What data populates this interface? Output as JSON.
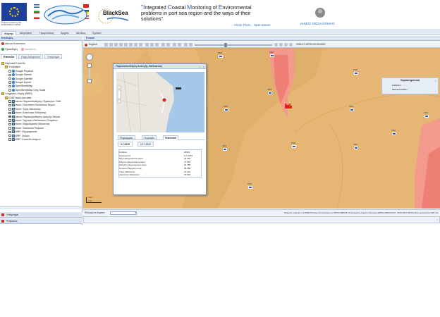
{
  "header": {
    "eu_caption": "Project funded by the EUROPEAN UNION",
    "title_segments": [
      {
        "cap": "\"I",
        "rest": "ntegrated "
      },
      {
        "cap": "C",
        "rest": "oastal "
      },
      {
        "cap": "M",
        "rest": "onitoring of "
      },
      {
        "cap": "E",
        "rest": "nvironmental"
      }
    ],
    "title_line2": "problems in port sea region and the ways of their",
    "title_line3": "solutions\"",
    "slogan": "Clean Ports... Open Doors",
    "municipality": "ΔΗΜΟΣ ΘΕΣΣΑΛΟΝΙΚΗΣ",
    "blacksea_logo": "BlackSea"
  },
  "menu": [
    "Χάρτης",
    "Μετρήσεις",
    "Προγνώσεις",
    "Αρχεία",
    "Μελέτες",
    "Σχετικά"
  ],
  "left": {
    "panel_title": "Επιλογές",
    "lang": "Δίκτυο Κατόπτων",
    "tools": [
      "Προσθήκη",
      "Αφαίρεση"
    ],
    "tabs": [
      "Επίπεδα",
      "Πηγή Δεδομένων",
      "Υπόμνημα"
    ],
    "tree": [
      {
        "label": "Θεματικά Επίπεδα",
        "indent": 0,
        "kind": "folder"
      },
      {
        "label": "Υπόβαθρα",
        "indent": 1,
        "kind": "folder"
      },
      {
        "label": "Google Physical",
        "indent": 2,
        "kind": "globe"
      },
      {
        "label": "Google Streets",
        "indent": 2,
        "kind": "globe"
      },
      {
        "label": "Google Satellite",
        "indent": 2,
        "kind": "globe"
      },
      {
        "label": "Google Hybrid",
        "indent": 2,
        "kind": "globe"
      },
      {
        "label": "OpenStreetMap",
        "indent": 2,
        "kind": "globe"
      },
      {
        "label": "OpenStreetMap Grey Scale",
        "indent": 2,
        "kind": "globe"
      },
      {
        "label": "Υπηρεσίες Χάρτη (WMS)",
        "indent": 0,
        "kind": "folder"
      },
      {
        "label": "ICME black sea data",
        "indent": 1,
        "kind": "folder"
      },
      {
        "label": "Δίκτυο Παρακολούθησης Παράκτιων Υδάτ",
        "indent": 2,
        "kind": "check"
      },
      {
        "label": "ekom: Πυκνότητα Θαλάσσιου Νερού",
        "indent": 2,
        "kind": "check"
      },
      {
        "label": "ekom: Υψος Θάλασσας",
        "indent": 2,
        "kind": "check"
      },
      {
        "label": "ekom: Αλατότητα Θαλάσσης",
        "indent": 2,
        "kind": "check"
      },
      {
        "label": "Δίκτυο Παρακολούθησης Ακτογής Θάλασ",
        "indent": 2,
        "kind": "check-on"
      },
      {
        "label": "ekom: Ταχύτητα Θαλάσσιων Ρευμάτων",
        "indent": 2,
        "kind": "check"
      },
      {
        "label": "ekom: Θερμοκρασία Θάλασσας",
        "indent": 2,
        "kind": "check"
      },
      {
        "label": "ekom: Θαλάσσια Ρεύματα",
        "indent": 2,
        "kind": "check"
      },
      {
        "label": "WRF: Θερμοκρασία",
        "indent": 2,
        "kind": "check"
      },
      {
        "label": "WRF: Ανέμοι",
        "indent": 2,
        "kind": "check"
      },
      {
        "label": "WRF: Επίπεδο Ανέμων",
        "indent": 2,
        "kind": "check"
      }
    ],
    "bottom_panels": [
      "Υπόμνημα",
      "Ρυθμίσεις"
    ]
  },
  "map": {
    "tab": "Γενικά",
    "lang_label": "English",
    "datetime": "2015-07-09T22:00:00.000Z",
    "station_label": "UMA",
    "selected_station": "UMA",
    "legend": {
      "title": "Χαρακτηριστικά",
      "items": [
        "ΣΗΜΑΔΑ",
        "ΘΕΣΣΑΛΟΝΙΚΗ"
      ]
    },
    "scale": {
      "top": "1 km",
      "bottom": "1 mi"
    },
    "status_left": "Επιλογή σε κλίμακα:",
    "status_right": "Τρέχουσα κλίμακα: 1:136484  Σύστημα Συντεταγμένων: EPSG:900913  Συντεταγμένες Σημείου Κέρσορα (EPSG:4326):23.03 , 40.60  GET SDI Portal is powered by GET Ltd.",
    "colors": {
      "map_bg": "#eabd7a",
      "hot": "#f39a8c",
      "hotter": "#ee7f74",
      "sea": "#dfb06c"
    }
  },
  "popup": {
    "title": "Παρακολούθηση Ακτογής Θάλασσας",
    "tabs": [
      "Πληροφορίες",
      "Γεωμετρία",
      "Στατιστικά"
    ],
    "date_tabs": [
      "9-7-2015",
      "10-7-2015"
    ],
    "stats": [
      {
        "k": "Σταθμός",
        "v": "18954"
      },
      {
        "k": "Ημερομηνία",
        "v": "9-7-2015"
      },
      {
        "k": "Μέση Θερμοκρασία Αέρα",
        "v": "25.362"
      },
      {
        "k": "Μέγιστη Θερμοκρασία Αέρα",
        "v": "27.602"
      },
      {
        "k": "Ελάχιστη Θερμοκρασία Αέρα",
        "v": "23.798"
      },
      {
        "k": "Ποσοστό Βροχόπτωσης",
        "v": "28.058"
      },
      {
        "k": "Υψος Θάλασσας",
        "v": "10.421"
      },
      {
        "k": "Αλατότητα Θάλασσας",
        "v": "37.801"
      }
    ]
  }
}
